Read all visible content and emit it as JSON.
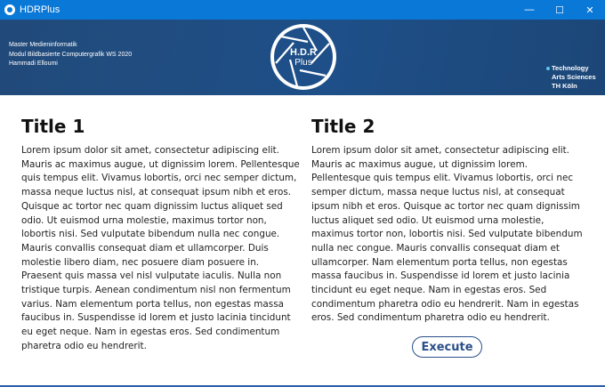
{
  "window": {
    "title": "HDRPlus",
    "controls": [
      "—",
      "☐",
      "✕"
    ]
  },
  "header": {
    "info_lines": [
      "Master Medieninformatik",
      "Modul Bildbasierte Computergrafik WS 2020",
      "Hammadi Elloumi"
    ],
    "logo_text_top": "H.D.R",
    "logo_text_bottom": "Plus",
    "institution_lines": [
      "Technology",
      "Arts Sciences",
      "TH Köln"
    ],
    "colors": {
      "header_bg": "#1e4f88",
      "titlebar_bg": "#0a78d7"
    }
  },
  "columns": [
    {
      "title": "Title 1",
      "body": "Lorem ipsum dolor sit amet, consectetur adipiscing elit. Mauris ac maximus augue, ut dignissim lorem. Pellentesque quis tempus elit. Vivamus lobortis, orci nec semper dictum, massa neque luctus nisl, at consequat ipsum nibh et eros. Quisque ac tortor nec quam dignissim luctus aliquet sed odio. Ut euismod urna molestie, maximus tortor non, lobortis nisi. Sed vulputate bibendum nulla nec congue. Mauris convallis consequat diam et ullamcorper. Duis molestie libero diam, nec posuere diam posuere in. Praesent quis massa vel nisl vulputate iaculis. Nulla non tristique turpis. Aenean condimentum nisl non fermentum varius. Nam elementum porta tellus, non egestas massa faucibus in. Suspendisse id lorem et justo lacinia tincidunt eu eget neque. Nam in egestas eros. Sed condimentum pharetra odio eu hendrerit."
    },
    {
      "title": "Title 2",
      "body": "Lorem ipsum dolor sit amet, consectetur adipiscing elit. Mauris ac maximus augue, ut dignissim lorem. Pellentesque quis tempus elit. Vivamus lobortis, orci nec semper dictum, massa neque luctus nisl, at consequat ipsum nibh et eros. Quisque ac tortor nec quam dignissim luctus aliquet sed odio. Ut euismod urna molestie, maximus tortor non, lobortis nisi. Sed vulputate bibendum nulla nec congue. Mauris convallis consequat diam et ullamcorper. Nam elementum porta tellus, non egestas massa faucibus in. Suspendisse id lorem et justo lacinia tincidunt eu eget neque. Nam in egestas eros. Sed condimentum pharetra odio eu hendrerit. Nam in egestas eros. Sed condimentum pharetra odio eu hendrerit."
    }
  ],
  "actions": {
    "execute_label": "Execute"
  }
}
